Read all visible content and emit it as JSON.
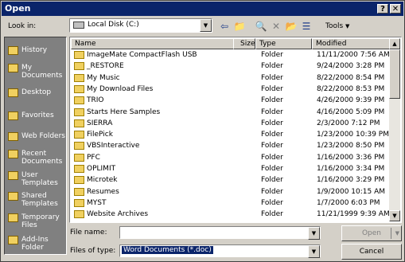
{
  "window": {
    "title": "Open",
    "help_btn": "?",
    "close_btn": "✕"
  },
  "toolbar": {
    "look_in_label": "Look in:",
    "look_in_value": "Local Disk (C:)",
    "tools_label": "Tools"
  },
  "sidebar": [
    {
      "name": "sidebar-item-history",
      "label": "History"
    },
    {
      "name": "sidebar-item-my-documents",
      "label": "My Documents"
    },
    {
      "name": "sidebar-item-desktop",
      "label": "Desktop"
    },
    {
      "name": "sidebar-item-favorites",
      "label": "Favorites"
    },
    {
      "name": "sidebar-item-web-folders",
      "label": "Web Folders"
    },
    {
      "name": "sidebar-item-recent-documents",
      "label": "Recent Documents"
    },
    {
      "name": "sidebar-item-user-templates",
      "label": "User Templates"
    },
    {
      "name": "sidebar-item-shared-templates",
      "label": "Shared Templates"
    },
    {
      "name": "sidebar-item-temporary-files",
      "label": "Temporary Files"
    },
    {
      "name": "sidebar-item-add-ins-folder",
      "label": "Add-Ins Folder"
    }
  ],
  "list": {
    "columns": {
      "name": "Name",
      "size": "Size",
      "type": "Type",
      "modified": "Modified"
    },
    "rows": [
      {
        "name": "ImageMate CompactFlash USB",
        "type": "Folder",
        "modified": "11/11/2000 7:56 AM"
      },
      {
        "name": "_RESTORE",
        "type": "Folder",
        "modified": "9/24/2000 3:28 PM"
      },
      {
        "name": "My Music",
        "type": "Folder",
        "modified": "8/22/2000 8:54 PM"
      },
      {
        "name": "My Download Files",
        "type": "Folder",
        "modified": "8/22/2000 8:53 PM"
      },
      {
        "name": "TRIO",
        "type": "Folder",
        "modified": "4/26/2000 9:39 PM"
      },
      {
        "name": "Starts Here Samples",
        "type": "Folder",
        "modified": "4/16/2000 5:09 PM"
      },
      {
        "name": "SIERRA",
        "type": "Folder",
        "modified": "2/3/2000 7:12 PM"
      },
      {
        "name": "FilePick",
        "type": "Folder",
        "modified": "1/23/2000 10:39 PM"
      },
      {
        "name": "VBSInteractive",
        "type": "Folder",
        "modified": "1/23/2000 8:50 PM"
      },
      {
        "name": "PFC",
        "type": "Folder",
        "modified": "1/16/2000 3:36 PM"
      },
      {
        "name": "OPLIMIT",
        "type": "Folder",
        "modified": "1/16/2000 3:34 PM"
      },
      {
        "name": "Microtek",
        "type": "Folder",
        "modified": "1/16/2000 3:29 PM"
      },
      {
        "name": "Resumes",
        "type": "Folder",
        "modified": "1/9/2000 10:15 AM"
      },
      {
        "name": "MYST",
        "type": "Folder",
        "modified": "1/7/2000 6:03 PM"
      },
      {
        "name": "Website Archives",
        "type": "Folder",
        "modified": "11/21/1999 9:39 AM"
      }
    ]
  },
  "footer": {
    "file_name_label": "File name:",
    "file_name_value": "",
    "files_of_type_label": "Files of type:",
    "files_of_type_value": "Word Documents (*.doc)",
    "open_label": "Open",
    "cancel_label": "Cancel"
  }
}
